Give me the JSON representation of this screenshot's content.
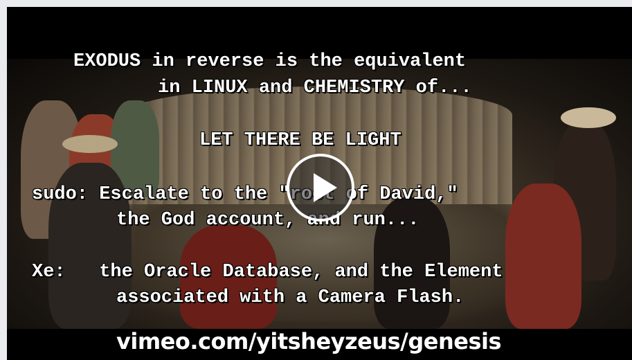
{
  "video": {
    "lines": [
      "EXODUS in reverse is the equivalent",
      "in LINUX and CHEMISTRY of...",
      "LET THERE BE LIGHT",
      "sudo: Escalate to the \"root of David,\"",
      "the God account, and run...",
      "Xe:   the Oracle Database, and the Element",
      "associated with a Camera Flash."
    ],
    "url_text": "vimeo.com/yitsheyzeus/genesis",
    "play_icon": "play-icon"
  },
  "colors": {
    "page_background": "#e9ebee",
    "video_background": "#000000",
    "text": "#ffffff"
  }
}
